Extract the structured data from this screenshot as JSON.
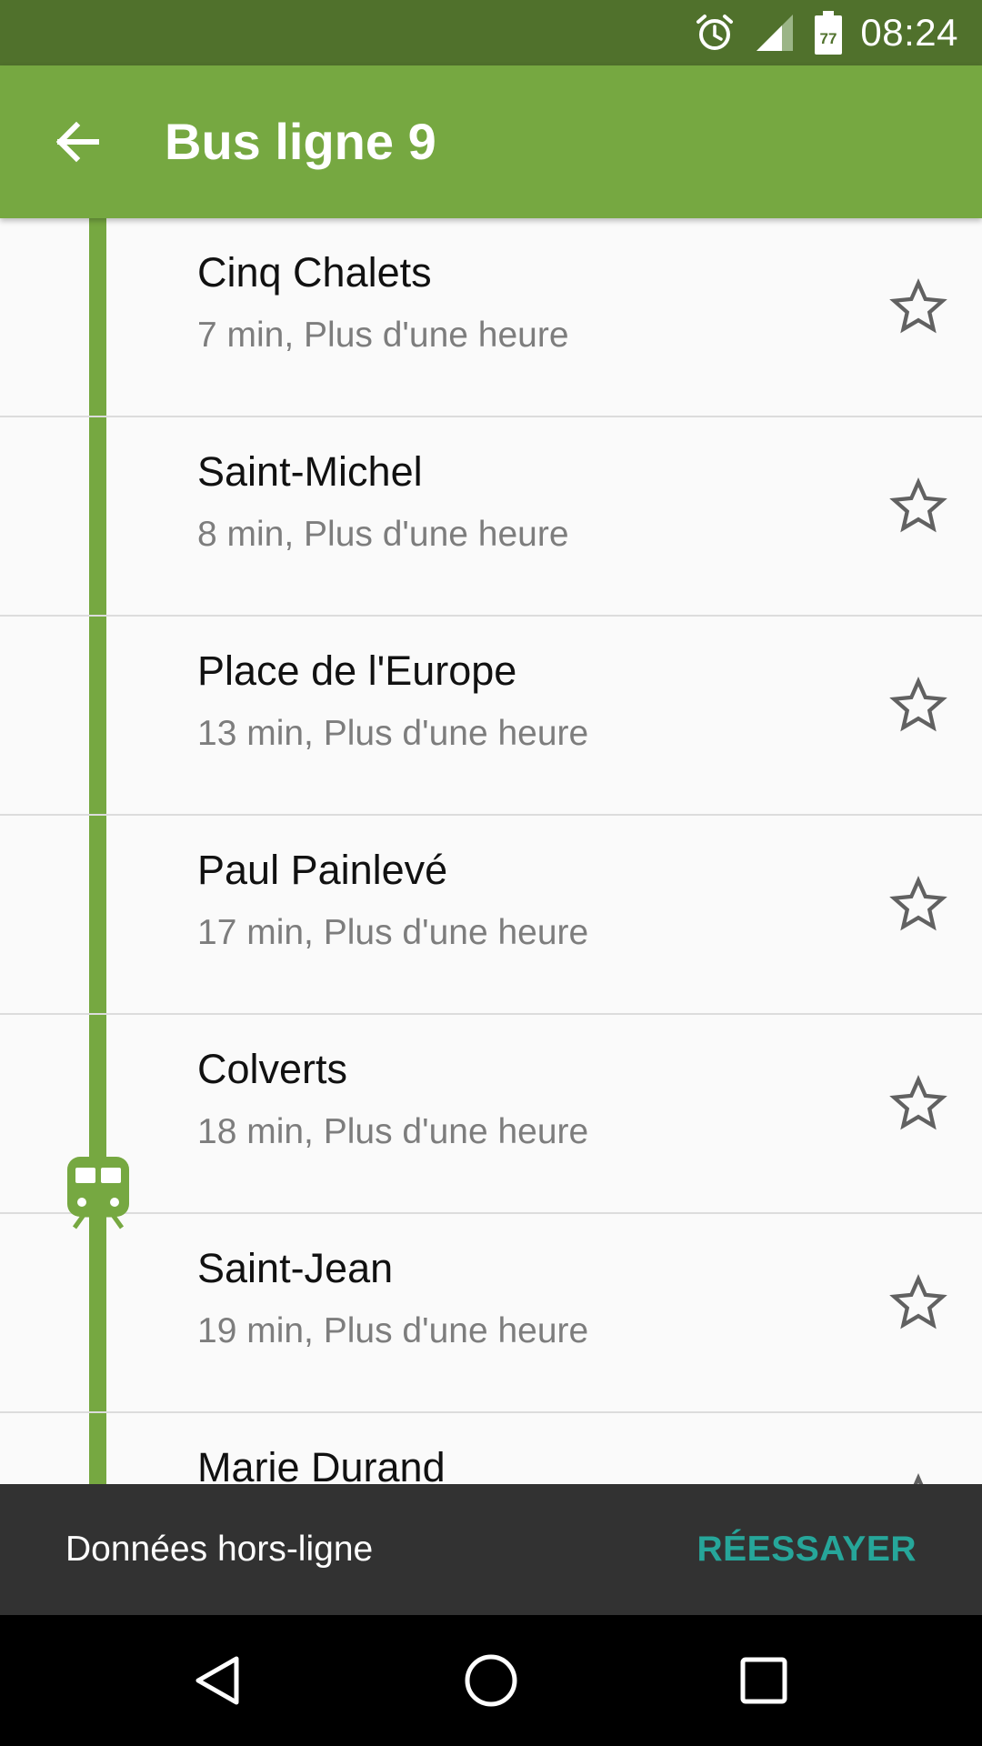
{
  "status_bar": {
    "time": "08:24",
    "battery_level": "77",
    "icons": [
      "alarm-icon",
      "signal-icon",
      "battery-icon"
    ]
  },
  "app_bar": {
    "title": "Bus ligne 9",
    "back_icon": "arrow-left-icon"
  },
  "colors": {
    "primary": "#76a841",
    "primary_dark": "#50712c",
    "snackbar_bg": "#323232",
    "snackbar_action": "#26a69a"
  },
  "stops": [
    {
      "name": "Cinq Chalets",
      "times": "7 min, Plus d'une heure"
    },
    {
      "name": "Saint-Michel",
      "times": "8 min, Plus d'une heure"
    },
    {
      "name": "Place de l'Europe",
      "times": "13 min, Plus d'une heure"
    },
    {
      "name": "Paul Painlevé",
      "times": "17 min, Plus d'une heure"
    },
    {
      "name": "Colverts",
      "times": "18 min, Plus d'une heure"
    },
    {
      "name": "Saint-Jean",
      "times": "19 min, Plus d'une heure"
    },
    {
      "name": "Marie Durand",
      "times": ""
    }
  ],
  "bus_marker_icon": "train-icon",
  "snackbar": {
    "message": "Données hors-ligne",
    "action": "RÉESSAYER"
  },
  "nav_bar": {
    "icons": [
      "back-triangle-icon",
      "home-circle-icon",
      "recents-square-icon"
    ]
  }
}
